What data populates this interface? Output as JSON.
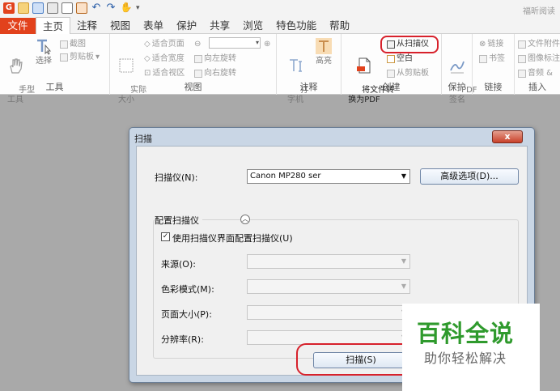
{
  "app": {
    "title": "福昕阅读"
  },
  "tabs": [
    {
      "label": "文件"
    },
    {
      "label": "主页"
    },
    {
      "label": "注释"
    },
    {
      "label": "视图"
    },
    {
      "label": "表单"
    },
    {
      "label": "保护"
    },
    {
      "label": "共享"
    },
    {
      "label": "浏览"
    },
    {
      "label": "特色功能"
    },
    {
      "label": "帮助"
    }
  ],
  "ribbon": {
    "tools": {
      "label": "工具",
      "hand": "手型\n工具",
      "select": "选择",
      "screenshot": "截图",
      "clipboard": "剪贴板"
    },
    "view": {
      "label": "视图",
      "actual_size": "实际\n大小",
      "fit_page": "适合页面",
      "fit_width": "适合宽度",
      "fit_view": "适合视区",
      "rotate_left": "向左旋转",
      "rotate_right": "向右旋转"
    },
    "annot": {
      "label": "注释",
      "typewriter": "打\n字机",
      "highlight": "高亮"
    },
    "create": {
      "label": "创建",
      "file_to_pdf": "将文件转\n换为PDF",
      "from_scanner": "从扫描仪",
      "blank": "空白",
      "from_clipboard": "从剪贴板"
    },
    "protect": {
      "label": "保护",
      "pdf_sign": "PDF\n签名"
    },
    "links": {
      "label": "链接",
      "link": "链接",
      "bookmark": "书签"
    },
    "insert": {
      "label": "插入",
      "file_attach": "文件附件",
      "image_annot": "图像标注",
      "audio_video": "音频 &"
    }
  },
  "dialog": {
    "title": "扫描",
    "close_label": "x",
    "scanner_label": "扫描仪(N):",
    "scanner_value": "Canon MP280 ser",
    "advanced_button": "高级选项(D)...",
    "config_section": "配置扫描仪",
    "use_ui_checkbox": "使用扫描仪界面配置扫描仪(U)",
    "use_ui_checked": true,
    "source_label": "来源(O):",
    "color_label": "色彩模式(M):",
    "page_size_label": "页面大小(P):",
    "resolution_label": "分辨率(R):",
    "scan_button": "扫描(S)"
  },
  "watermark": {
    "line1": "百科全说",
    "line2": "助你轻松解决"
  },
  "colors": {
    "accent": "#e2421c",
    "highlight": "#d7212b",
    "watermark": "#2f9a2d"
  }
}
